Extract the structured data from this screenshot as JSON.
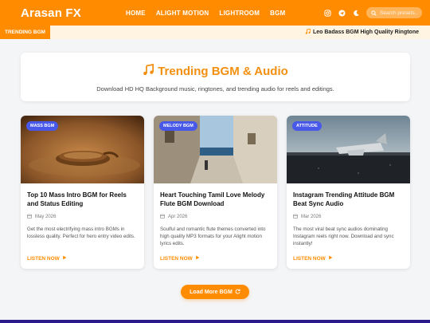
{
  "header": {
    "brand": "Arasan FX",
    "nav": [
      "HOME",
      "ALIGHT MOTION",
      "LIGHTROOM",
      "BGM"
    ],
    "search_placeholder": "Search presets..."
  },
  "ticker": {
    "label": "TRENDING BGM",
    "text": "Leo Badass BGM High Quality Ringtone"
  },
  "hero": {
    "title": "Trending BGM & Audio",
    "subtitle": "Download HD HQ Background music, ringtones, and trending audio for reels and editings."
  },
  "cards": [
    {
      "badge": "MASS BGM",
      "title": "Top 10 Mass Intro BGM for Reels and Status Editing",
      "date": "May 2026",
      "desc": "Get the most electrifying mass intro BGMs in lossless quality. Perfect for hero entry video edits.",
      "link": "LISTEN NOW"
    },
    {
      "badge": "MELODY BGM",
      "title": "Heart Touching Tamil Love Melody Flute BGM Download",
      "date": "Apr 2026",
      "desc": "Soulful and romantic flute themes converted into high quality MP3 formats for your Alight motion lyrics edits.",
      "link": "LISTEN NOW"
    },
    {
      "badge": "ATTITUDE",
      "title": "Instagram Trending Attitude BGM Beat Sync Audio",
      "date": "Mar 2026",
      "desc": "The most viral beat sync audios dominating Instagram reels right now. Download and sync instantly!",
      "link": "LISTEN NOW"
    }
  ],
  "load_more": "Load More BGM",
  "colors": {
    "accent": "#ff8c00",
    "badge": "#4858e8"
  }
}
